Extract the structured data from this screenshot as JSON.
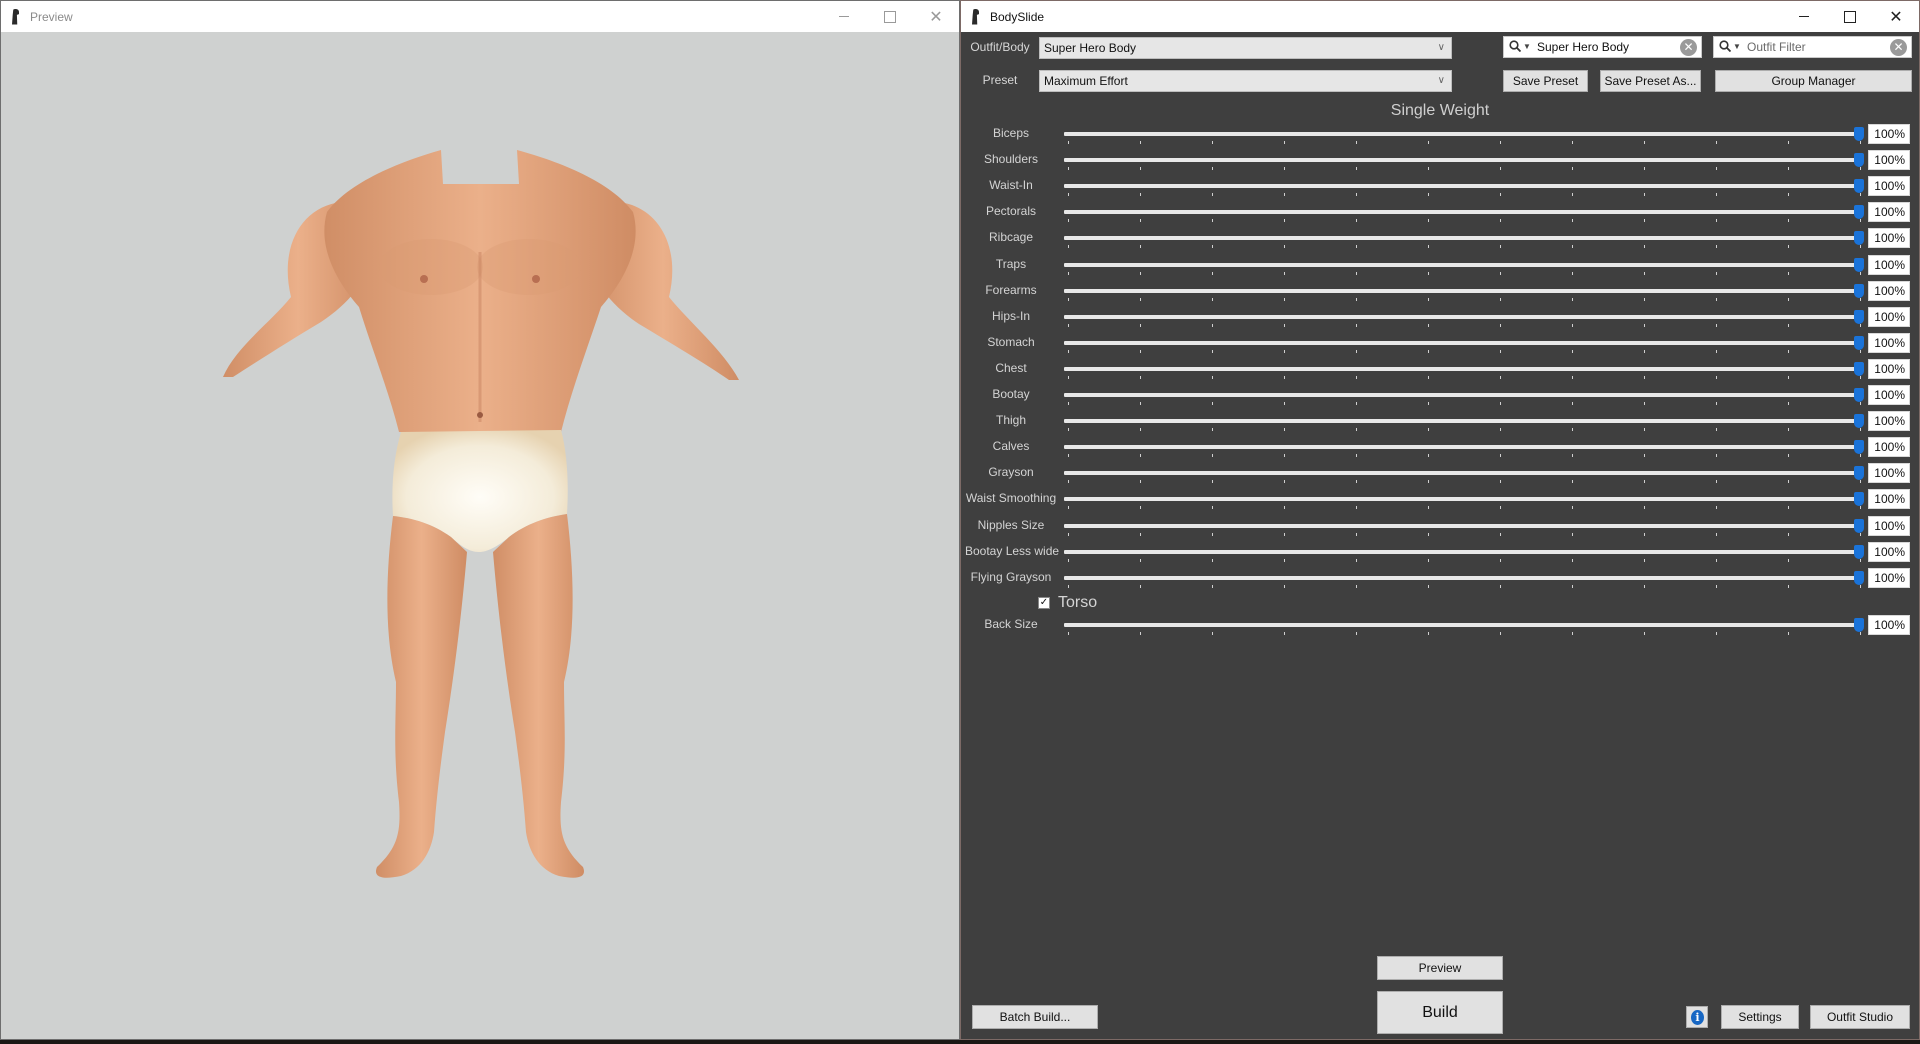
{
  "preview_window": {
    "title": "Preview",
    "app_icon": "bodyslide-figure-icon",
    "caption": {
      "minimize": "minimize-icon",
      "maximize": "maximize-icon",
      "close": "✕"
    },
    "viewport": {
      "background": "#cfd1d0",
      "model": "3d-male-body-mesh",
      "skin_color": "#e0a27c",
      "underwear_color": "#f3ead8"
    }
  },
  "bodyslide_window": {
    "title": "BodySlide",
    "app_icon": "bodyslide-figure-icon",
    "caption": {
      "minimize": "minimize-icon",
      "maximize": "maximize-icon",
      "close": "✕"
    },
    "outfit_body": {
      "label": "Outfit/Body",
      "value": "Super Hero Body"
    },
    "outfit_search": {
      "value": "Super Hero Body",
      "placeholder": ""
    },
    "outfit_filter": {
      "value": "",
      "placeholder": "Outfit Filter"
    },
    "preset": {
      "label": "Preset",
      "value": "Maximum Effort"
    },
    "buttons": {
      "save_preset": "Save Preset",
      "save_preset_as": "Save Preset As...",
      "group_manager": "Group Manager",
      "preview": "Preview",
      "build": "Build",
      "batch_build": "Batch Build...",
      "settings": "Settings",
      "outfit_studio": "Outfit Studio",
      "info": "i"
    },
    "section_title": "Single Weight",
    "sliders": [
      {
        "label": "Biceps",
        "value": 100,
        "display": "100%"
      },
      {
        "label": "Shoulders",
        "value": 100,
        "display": "100%"
      },
      {
        "label": "Waist-In",
        "value": 100,
        "display": "100%"
      },
      {
        "label": "Pectorals",
        "value": 100,
        "display": "100%"
      },
      {
        "label": "Ribcage",
        "value": 100,
        "display": "100%"
      },
      {
        "label": "Traps",
        "value": 100,
        "display": "100%"
      },
      {
        "label": "Forearms",
        "value": 100,
        "display": "100%"
      },
      {
        "label": "Hips-In",
        "value": 100,
        "display": "100%"
      },
      {
        "label": "Stomach",
        "value": 100,
        "display": "100%"
      },
      {
        "label": "Chest",
        "value": 100,
        "display": "100%"
      },
      {
        "label": "Bootay",
        "value": 100,
        "display": "100%"
      },
      {
        "label": "Thigh",
        "value": 100,
        "display": "100%"
      },
      {
        "label": "Calves",
        "value": 100,
        "display": "100%"
      },
      {
        "label": "Grayson",
        "value": 100,
        "display": "100%"
      },
      {
        "label": "Waist Smoothing",
        "value": 100,
        "display": "100%"
      },
      {
        "label": "Nipples Size",
        "value": 100,
        "display": "100%"
      },
      {
        "label": "Bootay Less wide",
        "value": 100,
        "display": "100%"
      },
      {
        "label": "Flying Grayson",
        "value": 100,
        "display": "100%"
      }
    ],
    "groups": [
      {
        "label": "Torso",
        "checked": true,
        "sliders": [
          {
            "label": "Back Size",
            "value": 100,
            "display": "100%"
          }
        ]
      }
    ],
    "slider_range": [
      0,
      100
    ],
    "colors": {
      "background": "#3f3f3f",
      "accent_thumb": "#1a73d9",
      "info_icon": "#1767c4"
    }
  }
}
